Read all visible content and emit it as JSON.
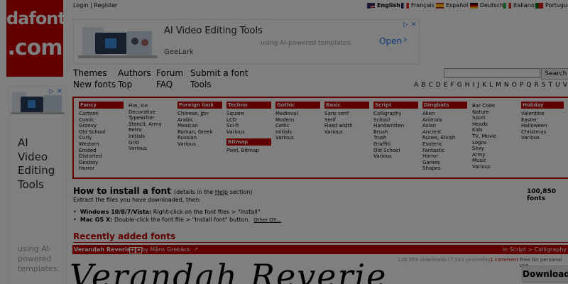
{
  "top": {
    "login": "Login",
    "sep": "|",
    "register": "Register"
  },
  "languages": [
    {
      "label": "English",
      "active": true
    },
    {
      "label": "Français"
    },
    {
      "label": "Español"
    },
    {
      "label": "Deutsch"
    },
    {
      "label": "Italiano"
    },
    {
      "label": "Português"
    }
  ],
  "logo": {
    "line1": "dafont",
    "line2": ".com"
  },
  "ad_top": {
    "title": "AI Video Editing Tools",
    "subtitle": "using AI-powered templates.",
    "brand": "GeeLark",
    "cta": "Open",
    "chevron": "›"
  },
  "nav": {
    "themes": "Themes",
    "authors": "Authors",
    "forum": "Forum",
    "submit": "Submit a font",
    "new_fonts": "New fonts",
    "top": "Top",
    "faq": "FAQ",
    "tools": "Tools"
  },
  "search": {
    "placeholder": "",
    "button": "Search"
  },
  "alphabet": "A B C D E F G H I J K L M N O P Q R S T U V W X Y Z #",
  "ad_side": {
    "big": [
      "AI",
      "Video",
      "Editing",
      "Tools"
    ],
    "small": [
      "using AI-",
      "powered",
      "templates."
    ]
  },
  "categories": [
    {
      "head": "Fancy",
      "items": [
        "Cartoon",
        "Comic",
        "Groovy",
        "Old School",
        "Curly",
        "Western",
        "Eroded",
        "Distorted",
        "Destroy",
        "Horror"
      ]
    },
    {
      "head": "",
      "items": [
        "Fire, Ice",
        "Decorative",
        "Typewriter",
        "Stencil, Army",
        "Retro",
        "Initials",
        "Grid",
        "Various"
      ]
    },
    {
      "head": "Foreign look",
      "items": [
        "Chinese, Jpn",
        "Arabic",
        "Mexican",
        "Roman, Greek",
        "Russian",
        "Various"
      ]
    },
    {
      "head": "Techno",
      "items": [
        "Square",
        "LCD",
        "Sci-fi",
        "Various"
      ],
      "head2": "Bitmap",
      "items2": [
        "Pixel, Bitmap"
      ]
    },
    {
      "head": "Gothic",
      "items": [
        "Medieval",
        "Modern",
        "Celtic",
        "Initials",
        "Various"
      ]
    },
    {
      "head": "Basic",
      "items": [
        "Sans serif",
        "Serif",
        "Fixed width",
        "Various"
      ]
    },
    {
      "head": "Script",
      "items": [
        "Calligraphy",
        "School",
        "Handwritten",
        "Brush",
        "Trash",
        "Graffiti",
        "Old School",
        "Various"
      ]
    },
    {
      "head": "Dingbats",
      "items": [
        "Alien",
        "Animals",
        "Asian",
        "Ancient",
        "Runes, Elvish",
        "Esoteric",
        "Fantastic",
        "Horror",
        "Games",
        "Shapes"
      ]
    },
    {
      "head": "",
      "items": [
        "Bar Code",
        "Nature",
        "Sport",
        "Heads",
        "Kids",
        "TV, Movie",
        "Logos",
        "Sexy",
        "Army",
        "Music",
        "Various"
      ]
    },
    {
      "head": "Holiday",
      "items": [
        "Valentine",
        "Easter",
        "Halloween",
        "Christmas",
        "Various"
      ]
    }
  ],
  "install": {
    "title": "How to install a font",
    "details_pre": "(details in the ",
    "details_link": "Help",
    "details_post": " section)",
    "count": "100,850 fonts",
    "extract": "Extract the files you have downloaded, then:",
    "win_label": "Windows 10/8/7/Vista:",
    "win_text": " Right-click on the font files > \"Install\"",
    "mac_label": "Mac OS X:",
    "mac_text": " Double-click the font file > \"Install font\" button.",
    "other_os": "Other OS..."
  },
  "recent": {
    "title": "Recently added fonts",
    "font_name": "Verandah Reverie",
    "by": "by Måns Grebäck",
    "category": "in Script > Calligraphy",
    "stats": "126,959 downloads (7,543 yesterday)",
    "comment": "1 comment",
    "license": "Free for personal use",
    "download": "Download",
    "preview": "Verandah Reverie"
  },
  "colors": {
    "brand": "#c40000",
    "overlay": "rgba(0,0,0,0.5)"
  }
}
